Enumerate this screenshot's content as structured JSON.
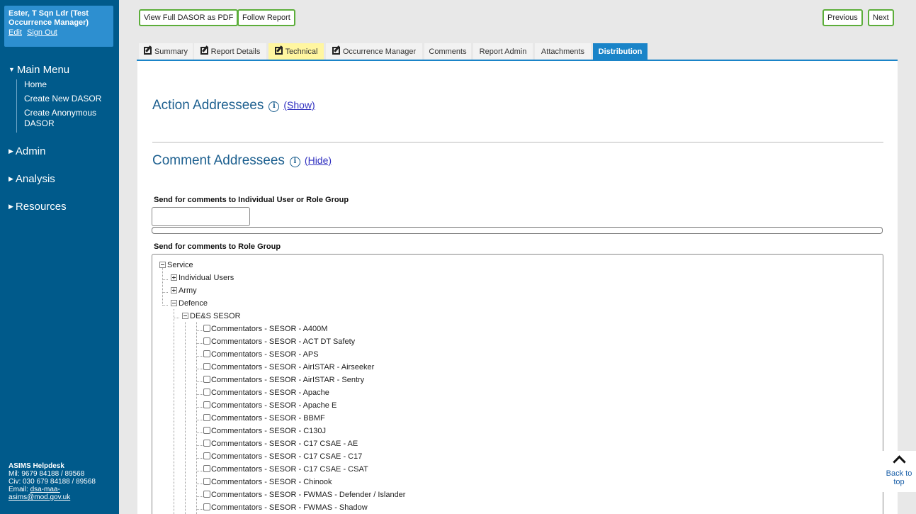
{
  "user": {
    "name": "Ester, T Sqn Ldr (Test Occurrence Manager)",
    "edit": "Edit",
    "sign_out": "Sign Out"
  },
  "menu": {
    "main": "Main Menu",
    "main_items": [
      "Home",
      "Create New DASOR",
      "Create Anonymous DASOR"
    ],
    "admin": "Admin",
    "analysis": "Analysis",
    "resources": "Resources"
  },
  "helpdesk": {
    "title": "ASIMS Helpdesk",
    "mil": "Mil: 9679 84188 / 89568",
    "civ": "Civ: 030 679 84188 / 89568",
    "email_label": "Email: ",
    "email_1": "dsa-maa-",
    "email_2": "asims@mod.gov.uk"
  },
  "toolbar": {
    "pdf": "View Full DASOR as PDF",
    "follow": "Follow Report",
    "previous": "Previous",
    "next": "Next"
  },
  "tabs": [
    "Summary",
    "Report Details",
    "Technical",
    "Occurrence Manager",
    "Comments",
    "Report Admin",
    "Attachments",
    "Distribution"
  ],
  "action": {
    "title": "Action Addressees",
    "link": "(Show)"
  },
  "comment": {
    "title": "Comment Addressees",
    "link": "(Hide)",
    "individual_label": "Send for comments to Individual User or Role Group",
    "role_label": "Send for comments to Role Group"
  },
  "tree": {
    "service": "Service",
    "individual_users": "Individual Users",
    "army": "Army",
    "defence": "Defence",
    "des_sesor": "DE&S SESOR",
    "items": [
      "Commentators - SESOR - A400M",
      "Commentators - SESOR - ACT DT Safety",
      "Commentators - SESOR - APS",
      "Commentators - SESOR - AirISTAR - Airseeker",
      "Commentators - SESOR - AirISTAR - Sentry",
      "Commentators - SESOR - Apache",
      "Commentators - SESOR - Apache E",
      "Commentators - SESOR - BBMF",
      "Commentators - SESOR - C130J",
      "Commentators - SESOR - C17 CSAE - AE",
      "Commentators - SESOR - C17 CSAE - C17",
      "Commentators - SESOR - C17 CSAE - CSAT",
      "Commentators - SESOR - Chinook",
      "Commentators - SESOR - FWMAS - Defender / Islander",
      "Commentators - SESOR - FWMAS - Shadow"
    ]
  },
  "back_to_top": {
    "line1": "Back to",
    "line2": "top"
  }
}
